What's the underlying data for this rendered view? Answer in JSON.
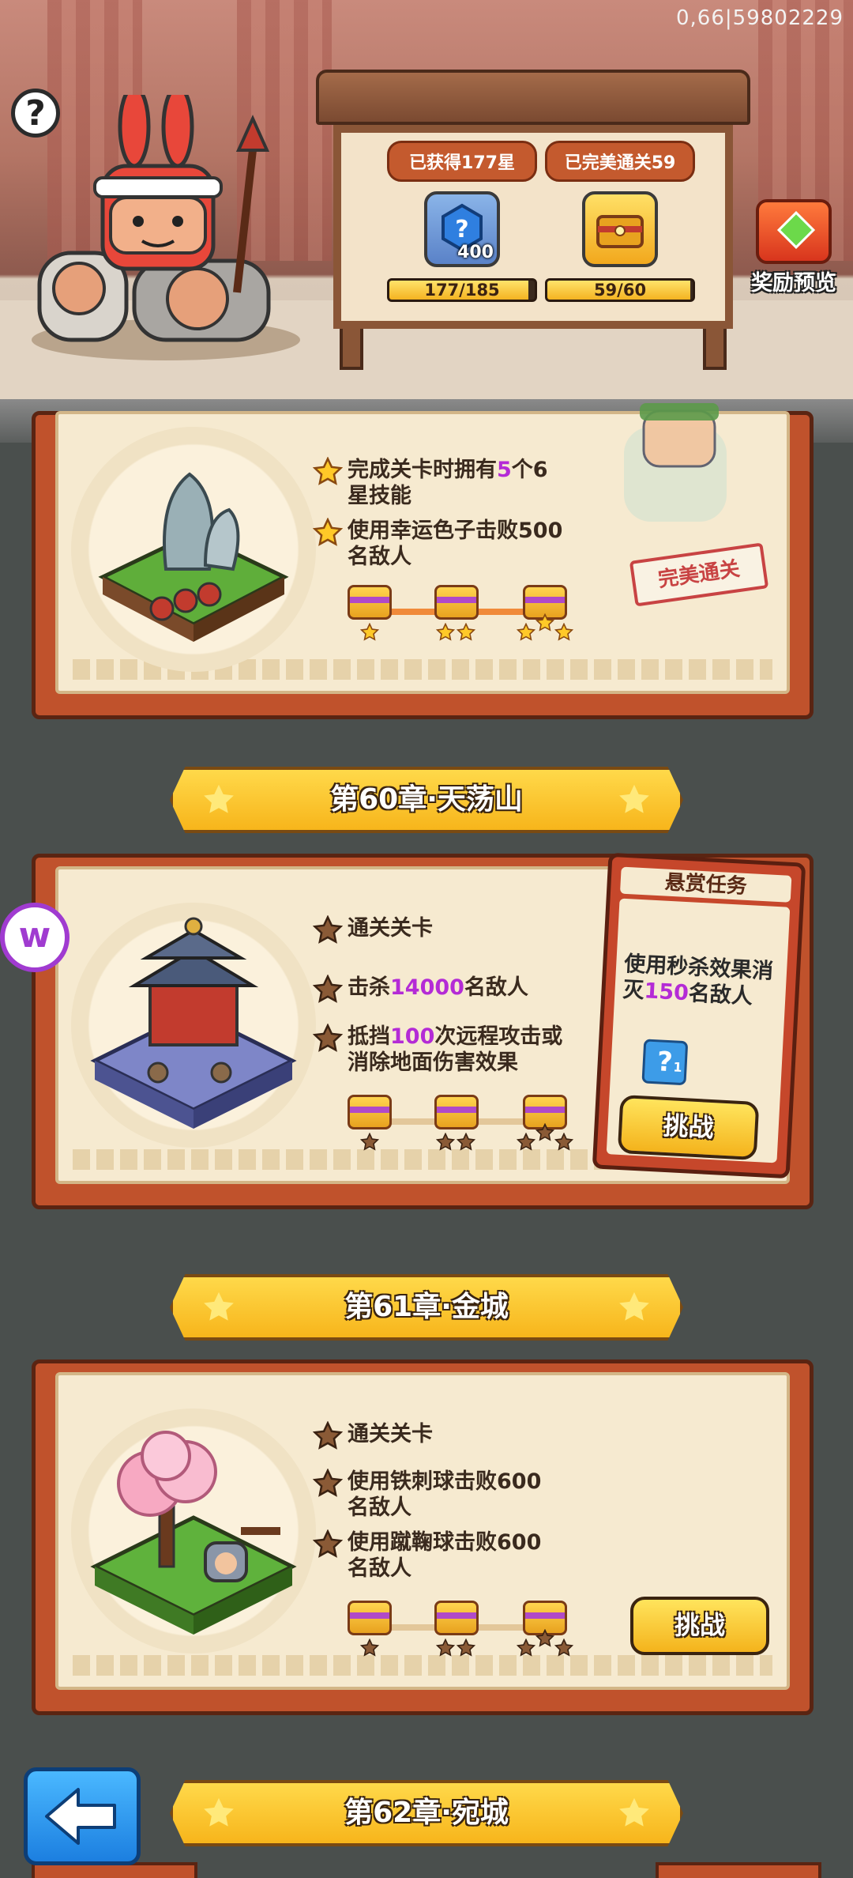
{
  "debug_text": "0,66|59802229",
  "header": {
    "help_icon": "question-mark-icon",
    "stars_label": "已获得177星",
    "perfect_label": "已完美通关59",
    "stars_count_badge": "400",
    "stars_progress": "177/185",
    "stars_fraction": 0.957,
    "perfect_progress": "59/60",
    "perfect_fraction": 0.983,
    "reward_preview_label": "奖励预览"
  },
  "chapter59": {
    "tasks": [
      {
        "prefix": "完成关卡时拥有",
        "highlight": "5",
        "suffix": "个6星技能"
      },
      {
        "text": "使用幸运色子击败500名敌人"
      }
    ],
    "stamp": "完美通关"
  },
  "chapter60": {
    "title": "第60章·天荡山",
    "tasks": [
      {
        "text": "通关关卡"
      },
      {
        "prefix": "击杀",
        "highlight": "14000",
        "suffix": "名敌人"
      },
      {
        "prefix": "抵挡",
        "highlight": "100",
        "suffix": "次远程攻击或消除地面伤害效果"
      }
    ],
    "bounty": {
      "title": "悬赏任务",
      "desc_prefix": "使用秒杀效果消灭",
      "desc_highlight": "150",
      "desc_suffix": "名敌人",
      "item_count": "1"
    },
    "challenge_label": "挑战"
  },
  "chapter61": {
    "title": "第61章·金城",
    "tasks": [
      {
        "text": "通关关卡"
      },
      {
        "text": "使用铁刺球击败600名敌人"
      },
      {
        "text": "使用蹴鞠球击败600名敌人"
      }
    ],
    "challenge_label": "挑战"
  },
  "chapter62": {
    "title": "第62章·宛城"
  },
  "colors": {
    "accent_gold": "#f7b51b",
    "book_red": "#c0522c",
    "highlight_purple": "#b42bd6",
    "highlight_red": "#d6233a",
    "star_earned": "#ffc928",
    "star_empty": "#7a4a2a"
  }
}
